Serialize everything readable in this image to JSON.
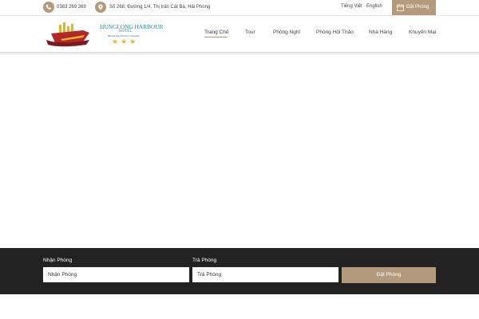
{
  "topbar": {
    "phone": "0383 269 269",
    "address": "Số 268, Đường 1/4, Thị trấn Cát Bà, Hải Phòng",
    "lang_vi": "Tiếng Việt",
    "lang_sep": " · ",
    "lang_en": "English",
    "book_label": "Đặt Phòng",
    "phone_icon": "phone-icon",
    "address_icon": "map-pin-icon",
    "book_icon": "calendar-icon"
  },
  "logo": {
    "line1": "HUNGLONG HARBOUR",
    "line2": "HOTEL",
    "line3": "HungLong Tourist Company",
    "stars": "★★★"
  },
  "nav": {
    "items": [
      "Trang Chủ",
      "Tour",
      "Phòng Nghỉ",
      "Phòng Hội Thảo",
      "Nhà Hàng",
      "Khuyến Mại"
    ],
    "active_index": 0
  },
  "booking": {
    "checkin_label": "Nhận Phòng",
    "checkin_placeholder": "Nhận Phòng",
    "checkout_label": "Trả Phòng",
    "checkout_placeholder": "Trả Phòng",
    "submit_label": "Đặt Phòng"
  },
  "colors": {
    "accent": "#b39a7c",
    "booking_bg": "#222222",
    "brand_teal": "#1a8f9a",
    "star_gold": "#e2b52a"
  }
}
